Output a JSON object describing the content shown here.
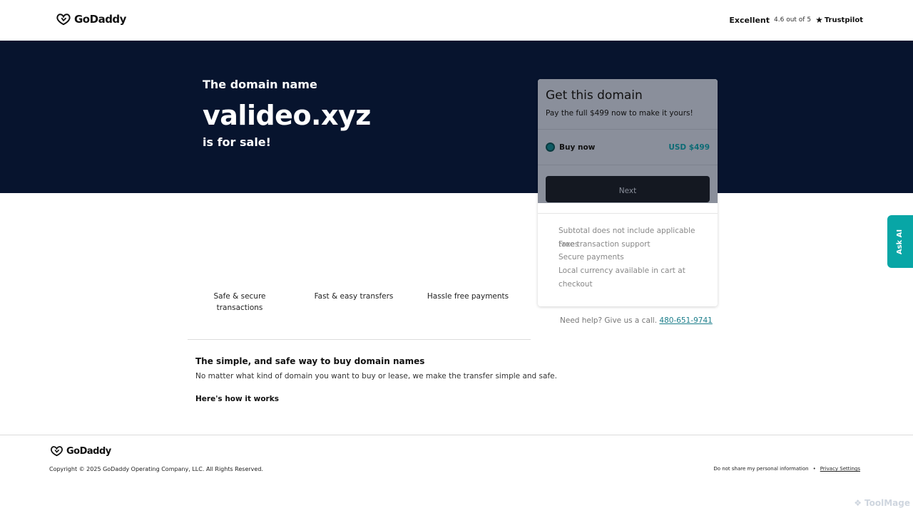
{
  "header": {
    "brand": "GoDaddy",
    "rating": {
      "word": "Excellent",
      "score": "4.6 out of 5",
      "provider": "Trustpilot"
    }
  },
  "hero": {
    "pre": "The domain name",
    "domain": "valideo.xyz",
    "post": "is for sale!"
  },
  "purchase_card": {
    "title": "Get this domain",
    "subtitle": "Pay the full $499 now to make it yours!",
    "option_label": "Buy now",
    "option_price": "USD $499",
    "next_label": "Next",
    "features": [
      "Subtotal does not include applicable taxes",
      "Free transaction support",
      "Secure payments",
      "Local currency available in cart at checkout"
    ]
  },
  "help": {
    "text": "Need help? Give us a call.",
    "phone": "480-651-9741"
  },
  "ask_ai": {
    "label": "Ask AI"
  },
  "features": {
    "f1": "Safe & secure transactions",
    "f2": "Fast & easy transfers",
    "f3": "Hassle free payments"
  },
  "info": {
    "title": "The simple, and safe way to buy domain names",
    "body": "No matter what kind of domain you want to buy or lease, we make the transfer simple and safe.",
    "how_link": "Here's how it works"
  },
  "footer": {
    "brand": "GoDaddy",
    "copyright": "Copyright © 2025 GoDaddy Operating Company, LLC. All Rights Reserved.",
    "do_not_share": "Do not share my personal information",
    "bullet": "•",
    "privacy": "Privacy Settings"
  },
  "watermark": "ToolMage",
  "colors": {
    "hero_bg": "#07142e",
    "accent_teal": "#08a6a6",
    "price_teal": "#0d6b75"
  }
}
